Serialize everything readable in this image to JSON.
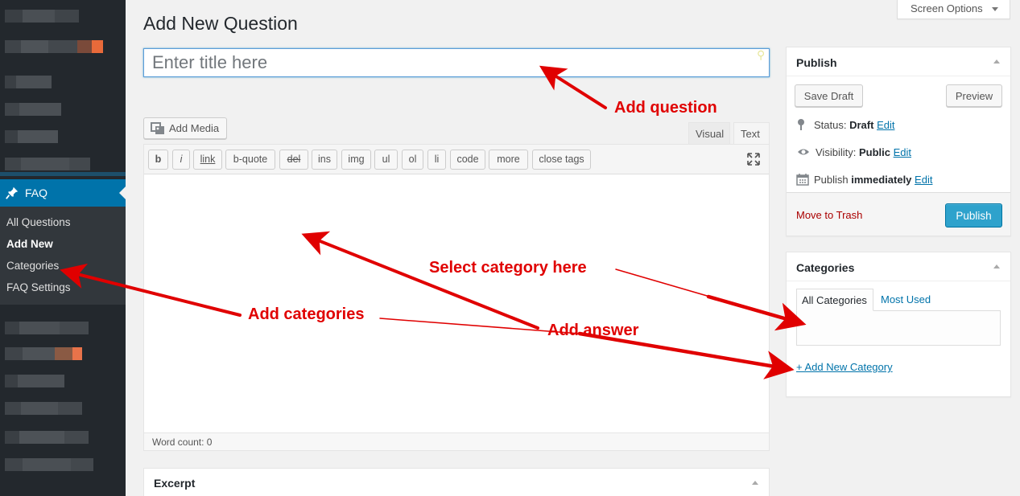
{
  "page": {
    "title": "Add New Question"
  },
  "screen_options": {
    "label": "Screen Options"
  },
  "sidebar": {
    "active_menu": {
      "label": "FAQ",
      "icon": "pushpin-icon"
    },
    "submenu": [
      {
        "label": "All Questions",
        "current": false
      },
      {
        "label": "Add New",
        "current": true
      },
      {
        "label": "Categories",
        "current": false
      },
      {
        "label": "FAQ Settings",
        "current": false
      }
    ]
  },
  "title_input": {
    "placeholder": "Enter title here",
    "value": ""
  },
  "editor": {
    "add_media_label": "Add Media",
    "tabs": {
      "visual": "Visual",
      "text": "Text"
    },
    "active_tab": "Text",
    "quicktags": [
      "b",
      "i",
      "link",
      "b-quote",
      "del",
      "ins",
      "img",
      "ul",
      "ol",
      "li",
      "code",
      "more",
      "close tags"
    ],
    "word_count": "Word count: 0"
  },
  "excerpt": {
    "title": "Excerpt"
  },
  "publish": {
    "title": "Publish",
    "save_draft": "Save Draft",
    "preview": "Preview",
    "status_label": "Status:",
    "status_value": "Draft",
    "visibility_label": "Visibility:",
    "visibility_value": "Public",
    "publish_prefix": "Publish",
    "publish_when": "immediately",
    "edit_link": "Edit",
    "move_to_trash": "Move to Trash",
    "publish_button": "Publish"
  },
  "categories": {
    "title": "Categories",
    "tab_all": "All Categories",
    "tab_used": "Most Used",
    "add_new_link": "+ Add New Category"
  },
  "annotations": {
    "add_question": "Add question",
    "select_category": "Select category here",
    "add_categories": "Add categories",
    "add_answer": "Add answer"
  },
  "colors": {
    "sidebar_bg": "#23282d",
    "submenu_bg": "#32373c",
    "accent_blue": "#0073aa",
    "publish_button": "#2ea2cc",
    "trash_red": "#aa0000",
    "annotation_red": "#e00000"
  }
}
